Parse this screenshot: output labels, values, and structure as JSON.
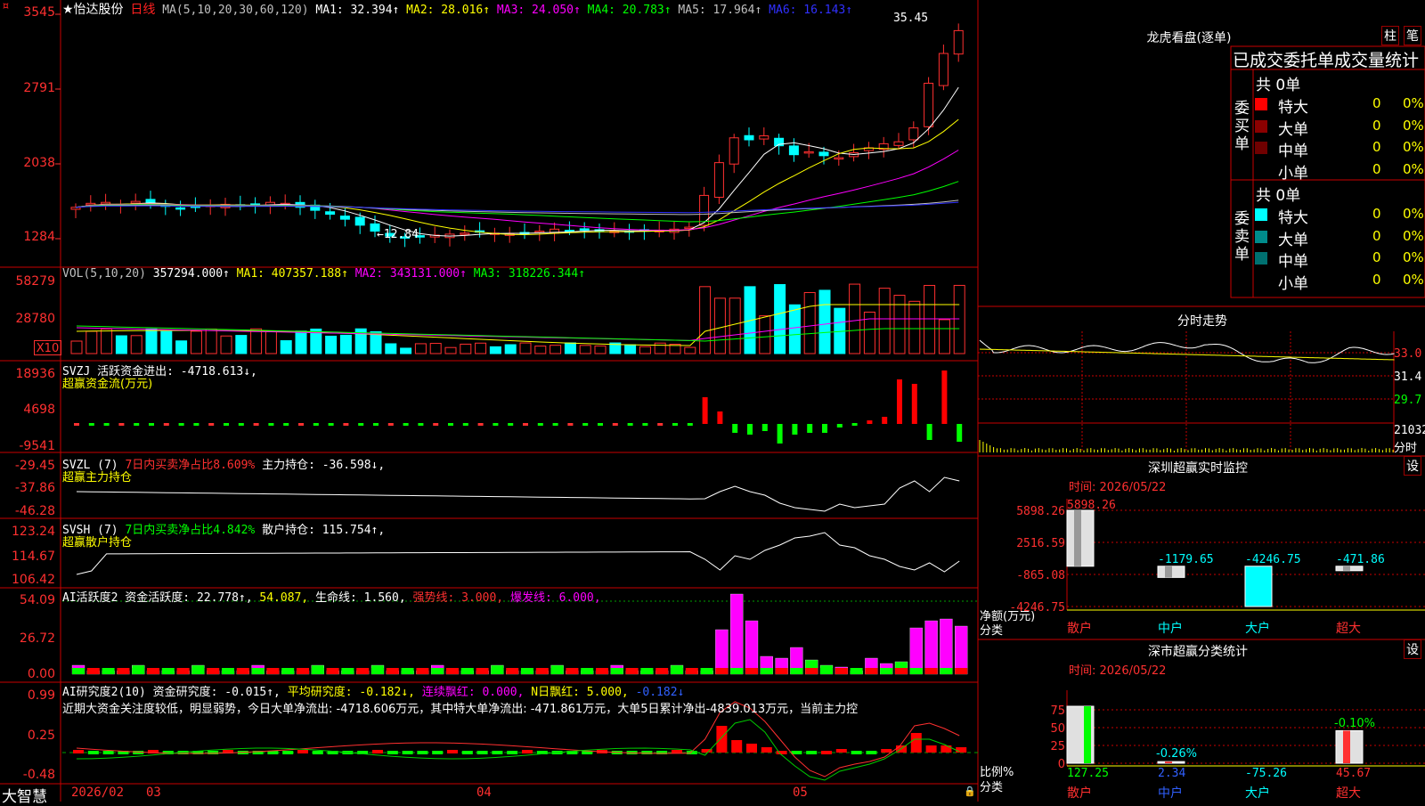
{
  "header": {
    "stock_name": "★怡达股份",
    "period": "日线",
    "ma_label": "MA(5,10,20,30,60,120)",
    "ma_values": [
      {
        "label": "MA1: 32.394↑",
        "color": "#ffffff"
      },
      {
        "label": "MA2: 28.016↑",
        "color": "#ffff00"
      },
      {
        "label": "MA3: 24.050↑",
        "color": "#ff00ff"
      },
      {
        "label": "MA4: 20.783↑",
        "color": "#00ff00"
      },
      {
        "label": "MA5: 17.964↑",
        "color": "#c0c0c0"
      },
      {
        "label": "MA6: 16.143↑",
        "color": "#3030ff"
      }
    ],
    "price_axis": [
      "3545",
      "2791",
      "2038",
      "1284"
    ],
    "high_mark": "35.45",
    "low_mark": "←12.84"
  },
  "volume": {
    "label": "VOL(5,10,20)",
    "value": "357294.000↑",
    "ma": [
      {
        "label": "MA1: 407357.188↑",
        "color": "#ffff00"
      },
      {
        "label": "MA2: 343131.000↑",
        "color": "#ff00ff"
      },
      {
        "label": "MA3: 318226.344↑",
        "color": "#00ff00"
      }
    ],
    "axis": [
      "58279",
      "28780"
    ],
    "unit": "X10"
  },
  "svzj": {
    "label": "SVZJ  活跃资金进出: -4718.613↓,",
    "sub": "超赢资金流(万元)",
    "axis": [
      "18936",
      "4698",
      "-9541"
    ]
  },
  "svzl": {
    "label_a": "SVZL (7)",
    "label_b": "7日内买卖净占比8.609%",
    "label_c": "主力持仓: -36.598↓,",
    "sub": "超赢主力持仓",
    "axis": [
      "-29.45",
      "-37.86",
      "-46.28"
    ]
  },
  "svsh": {
    "label_a": "SVSH (7)",
    "label_b": "7日内买卖净占比4.842%",
    "label_c": "散户持仓: 115.754↑,",
    "sub": "超赢散户持仓",
    "axis": [
      "123.24",
      "114.67",
      "106.42"
    ]
  },
  "ai_active": {
    "label_a": "AI活跃度2 资金活跃度: 22.778↑,",
    "label_b": "54.087,",
    "label_c": "生命线: 1.560,",
    "label_d": "强势线: 3.000,",
    "label_e": "爆发线: 6.000,",
    "axis": [
      "54.09",
      "26.72",
      "0.00"
    ]
  },
  "ai_research": {
    "label_a": "AI研究度2(10) 资金研究度: -0.015↑,",
    "label_b": "平均研究度: -0.182↓,",
    "label_c": "连续飘红: 0.000,",
    "label_d": "N日飘红: 5.000,",
    "label_e": "-0.182↓",
    "note": "近期大资金关注度较低，明显弱势，今日大单净流出: -4718.606万元，其中特大单净流出: -471.861万元，大单5日累计净出-4839.013万元，当前主力控",
    "axis": [
      "0.99",
      "0.25",
      "-0.48"
    ]
  },
  "date_axis": {
    "labels": [
      "2026/02",
      "03",
      "04",
      "05"
    ],
    "brand": "大智慧"
  },
  "longhu": {
    "title": "龙虎看盘(逐单)",
    "btn_a": "柱",
    "btn_b": "笔",
    "subtitle": "已成交委托单成交量统计",
    "buy_side": "委买单",
    "sell_side": "委卖单",
    "buy_total": "共 0单",
    "sell_total": "共 0单",
    "rows_buy": [
      {
        "name": "特大",
        "count": "0",
        "pct": "0%",
        "color": "#ff0000"
      },
      {
        "name": "大单",
        "count": "0",
        "pct": "0%",
        "color": "#8b0000"
      },
      {
        "name": "中单",
        "count": "0",
        "pct": "0%",
        "color": "#700000"
      },
      {
        "name": "小单",
        "count": "0",
        "pct": "0%",
        "color": ""
      }
    ],
    "rows_sell": [
      {
        "name": "特大",
        "count": "0",
        "pct": "0%",
        "color": "#00ffff"
      },
      {
        "name": "大单",
        "count": "0",
        "pct": "0%",
        "color": "#008b8b"
      },
      {
        "name": "中单",
        "count": "0",
        "pct": "0%",
        "color": "#007070"
      },
      {
        "name": "小单",
        "count": "0",
        "pct": "0%",
        "color": ""
      }
    ]
  },
  "intraday": {
    "title": "分时走势",
    "axis": [
      "33.0",
      "31.4",
      "29.7",
      "21032"
    ],
    "axis_suffix": "分时"
  },
  "sz_monitor": {
    "title": "深圳超赢实时监控",
    "btn": "设",
    "time": "时间: 2026/05/22",
    "ylabel_a": "净额(万元)",
    "ylabel_b": "分类",
    "axis": [
      "5898.26",
      "2516.59",
      "-865.08",
      "-4246.75"
    ],
    "categories": [
      "散户",
      "中户",
      "大户",
      "超大"
    ],
    "values_text": [
      "5898.26",
      "-1179.65",
      "-4246.75",
      "-471.86"
    ]
  },
  "sz_stats": {
    "title": "深市超赢分类统计",
    "btn": "设",
    "time": "时间: 2026/05/22",
    "ylabel_a": "比例%",
    "ylabel_b": "分类",
    "axis": [
      "75",
      "50",
      "25",
      "0"
    ],
    "categories": [
      "散户",
      "中户",
      "大户",
      "超大"
    ],
    "values_text": [
      "127.25",
      "2.34",
      "-75.26",
      "45.67"
    ],
    "top_a": "-0.26%",
    "top_b": "-0.10%"
  },
  "chart_data": [
    {
      "type": "bar",
      "categories": [
        "散户",
        "中户",
        "大户",
        "超大"
      ],
      "values": [
        5898.26,
        -1179.65,
        -4246.75,
        -471.86
      ],
      "title": "深圳超赢实时监控",
      "ylabel": "净额(万元)",
      "ylim": [
        -4246.75,
        5898.26
      ]
    },
    {
      "type": "bar",
      "categories": [
        "散户",
        "中户",
        "大户",
        "超大"
      ],
      "values": [
        127.25,
        2.34,
        -75.26,
        45.67
      ],
      "title": "深市超赢分类统计",
      "ylabel": "比例%",
      "ylim": [
        0,
        75
      ]
    }
  ]
}
